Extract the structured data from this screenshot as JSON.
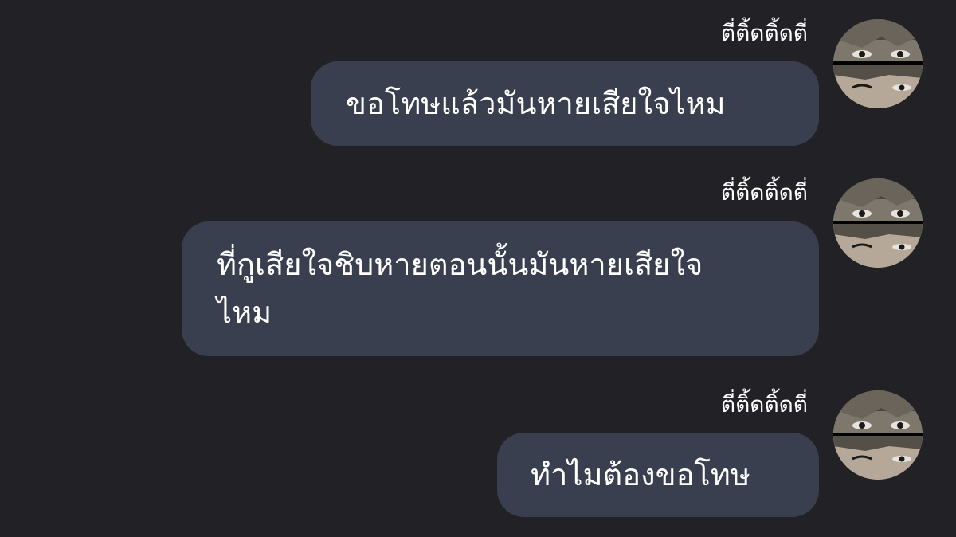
{
  "chat": {
    "messages": [
      {
        "sender": "ตี่ติ้ดติ้ดตี่",
        "avatar_icon": "user-avatar-photo",
        "text_lines": [
          "ขอโทษแล้วมันหายเสียใจไหม"
        ]
      },
      {
        "sender": "ตี่ติ้ดติ้ดตี่",
        "avatar_icon": "user-avatar-photo",
        "text_lines": [
          "ที่กูเสียใจชิบหายตอนนั้นมันหายเสียใจ",
          "ไหม"
        ]
      },
      {
        "sender": "ตี่ติ้ดติ้ดตี่",
        "avatar_icon": "user-avatar-photo",
        "text_lines": [
          "ทำไมต้องขอโทษ"
        ]
      }
    ]
  },
  "colors": {
    "background": "#222226",
    "bubble": "#3a3f4f",
    "text": "#ffffff"
  }
}
